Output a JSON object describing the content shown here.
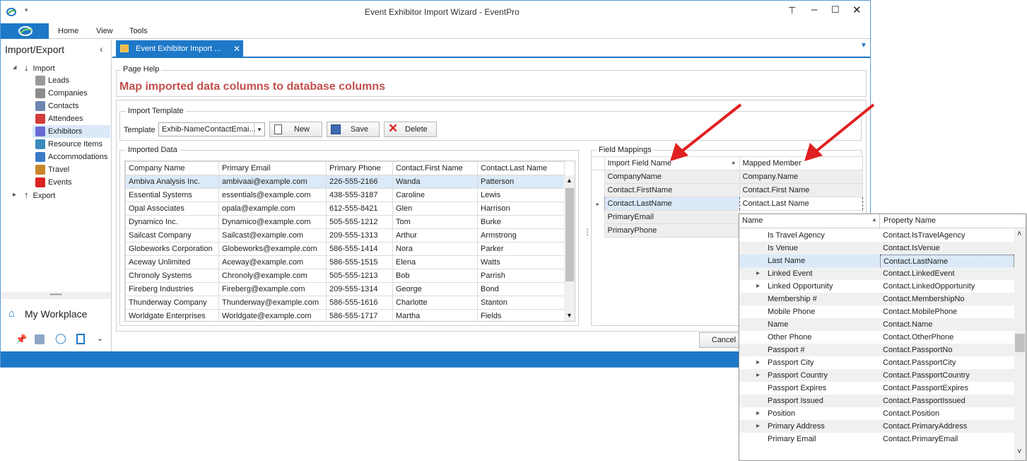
{
  "window": {
    "title": "Event Exhibitor Import Wizard - EventPro"
  },
  "ribbon": {
    "tabs": [
      "Home",
      "View",
      "Tools"
    ]
  },
  "nav": {
    "title": "Import/Export",
    "items": [
      {
        "label": "Import",
        "icon": "down-arrow-icon"
      },
      {
        "label": "Leads",
        "icon": "person-icon"
      },
      {
        "label": "Companies",
        "icon": "building-icon"
      },
      {
        "label": "Contacts",
        "icon": "contact-icon"
      },
      {
        "label": "Attendees",
        "icon": "attendee-icon"
      },
      {
        "label": "Exhibitors",
        "icon": "exhibitor-icon"
      },
      {
        "label": "Resource Items",
        "icon": "resource-icon"
      },
      {
        "label": "Accommodations",
        "icon": "hotel-icon"
      },
      {
        "label": "Travel",
        "icon": "travel-icon"
      },
      {
        "label": "Events",
        "icon": "pin-icon"
      },
      {
        "label": "Export",
        "icon": "up-arrow-icon"
      }
    ],
    "workplace": "My Workplace"
  },
  "doc_tab": {
    "label": "Event Exhibitor Import ..."
  },
  "page_help": {
    "legend": "Page Help",
    "heading": "Map imported data columns to database columns"
  },
  "template": {
    "legend": "Import Template",
    "label": "Template",
    "value": "Exhib-NameContactEmai...",
    "new": "New",
    "save": "Save",
    "delete": "Delete"
  },
  "imported": {
    "legend": "Imported Data",
    "columns": [
      "Company Name",
      "Primary Email",
      "Primary Phone",
      "Contact.First Name",
      "Contact.Last Name"
    ],
    "rows": [
      [
        "Ambiva Analysis Inc.",
        "ambivaai@example.com",
        "226-555-2166",
        "Wanda",
        "Patterson"
      ],
      [
        "Essential Systems",
        "essentials@example.com",
        "438-555-3187",
        "Caroline",
        "Lewis"
      ],
      [
        "Opal Associates",
        "opala@example.com",
        "612-555-8421",
        "Glen",
        "Harrison"
      ],
      [
        "Dynamico Inc.",
        "Dynamico@example.com",
        "505-555-1212",
        "Tom",
        "Burke"
      ],
      [
        "Sailcast Company",
        "Sailcast@example.com",
        "209-555-1313",
        "Arthur",
        "Armstrong"
      ],
      [
        "Globeworks Corporation",
        "Globeworks@example.com",
        "586-555-1414",
        "Nora",
        "Parker"
      ],
      [
        "Aceway Unlimited",
        "Aceway@example.com",
        "586-555-1515",
        "Elena",
        "Watts"
      ],
      [
        "Chronoly Systems",
        "Chronoly@example.com",
        "505-555-1213",
        "Bob",
        "Parrish"
      ],
      [
        "Fireberg Industries",
        "Fireberg@example.com",
        "209-555-1314",
        "George",
        "Bond"
      ],
      [
        "Thunderway Company",
        "Thunderway@example.com",
        "586-555-1616",
        "Charlotte",
        "Stanton"
      ],
      [
        "Worldgate Enterprises",
        "Worldgate@example.com",
        "586-555-1717",
        "Martha",
        "Fields"
      ]
    ]
  },
  "mappings": {
    "legend": "Field Mappings",
    "columns": [
      "Import Field Name",
      "Mapped Member"
    ],
    "rows": [
      [
        "CompanyName",
        "Company.Name"
      ],
      [
        "Contact.FirstName",
        "Contact.First Name"
      ],
      [
        "Contact.LastName",
        "Contact.Last Name"
      ],
      [
        "PrimaryEmail",
        ""
      ],
      [
        "PrimaryPhone",
        ""
      ]
    ]
  },
  "cancel": "Cancel",
  "popup": {
    "columns": [
      "Name",
      "Property Name"
    ],
    "rows": [
      {
        "name": "Is Travel Agency",
        "prop": "Contact.IsTravelAgency",
        "exp": false
      },
      {
        "name": "Is Venue",
        "prop": "Contact.IsVenue",
        "exp": false
      },
      {
        "name": "Last Name",
        "prop": "Contact.LastName",
        "exp": false
      },
      {
        "name": "Linked Event",
        "prop": "Contact.LinkedEvent",
        "exp": true
      },
      {
        "name": "Linked Opportunity",
        "prop": "Contact.LinkedOpportunity",
        "exp": true
      },
      {
        "name": "Membership #",
        "prop": "Contact.MembershipNo",
        "exp": false
      },
      {
        "name": "Mobile Phone",
        "prop": "Contact.MobilePhone",
        "exp": false
      },
      {
        "name": "Name",
        "prop": "Contact.Name",
        "exp": false
      },
      {
        "name": "Other Phone",
        "prop": "Contact.OtherPhone",
        "exp": false
      },
      {
        "name": "Passport #",
        "prop": "Contact.PassportNo",
        "exp": false
      },
      {
        "name": "Passport City",
        "prop": "Contact.PassportCity",
        "exp": true
      },
      {
        "name": "Passport Country",
        "prop": "Contact.PassportCountry",
        "exp": true
      },
      {
        "name": "Passport Expires",
        "prop": "Contact.PassportExpires",
        "exp": false
      },
      {
        "name": "Passport Issued",
        "prop": "Contact.PassportIssued",
        "exp": false
      },
      {
        "name": "Position",
        "prop": "Contact.Position",
        "exp": true
      },
      {
        "name": "Primary Address",
        "prop": "Contact.PrimaryAddress",
        "exp": true
      },
      {
        "name": "Primary Email",
        "prop": "Contact.PrimaryEmail",
        "exp": false
      }
    ]
  },
  "colors": {
    "accent": "#1e78c8",
    "heading": "#c0504d",
    "arrow": "#e02020",
    "selection": "#dbe9f8"
  }
}
